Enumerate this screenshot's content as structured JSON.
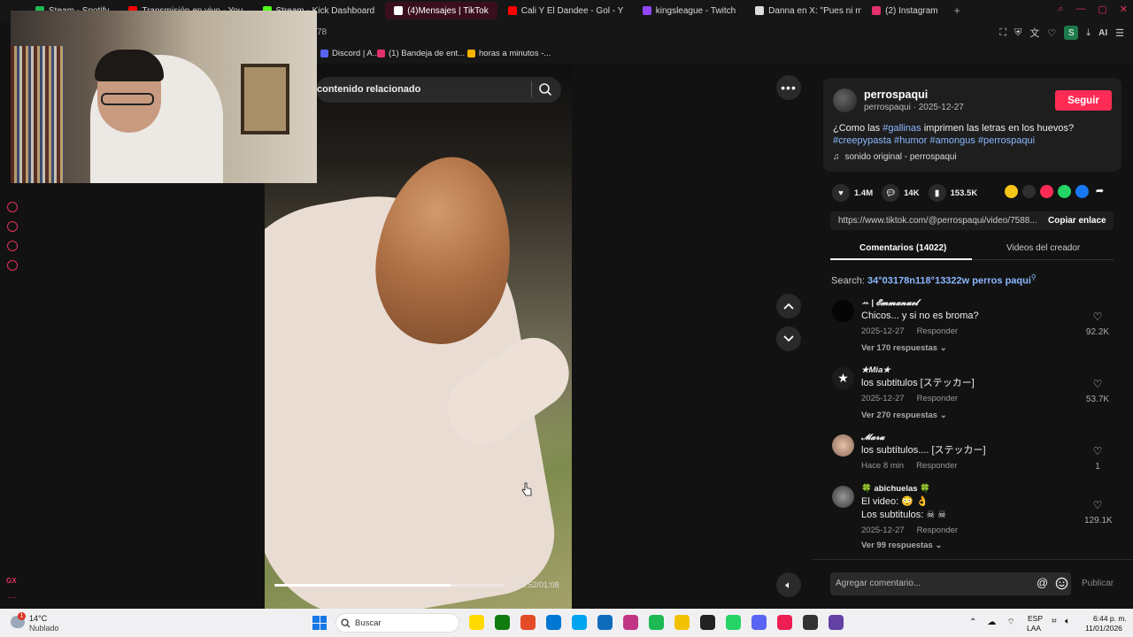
{
  "browser": {
    "tabs": [
      {
        "label": "Steam - Spotify",
        "color": "#1db954"
      },
      {
        "label": "Transmisión en vivo - You",
        "color": "#ff0000"
      },
      {
        "label": "Stream - Kick Dashboard",
        "color": "#53fc18"
      },
      {
        "label": "(4)Mensajes | TikTok",
        "color": "#ffffff"
      },
      {
        "label": "Cali Y El Dandee - Gol - Y",
        "color": "#ff0000"
      },
      {
        "label": "kingsleague - Twitch",
        "color": "#9146ff"
      },
      {
        "label": "Danna en X: \"Pues ni mod",
        "color": "#dddddd"
      },
      {
        "label": "(2) Instagram",
        "color": "#e1306c"
      }
    ],
    "new_tab": "+",
    "address_fragment": "78",
    "bookmarks": [
      {
        "label": "Discord | A...",
        "color": "#5865f2"
      },
      {
        "label": "(1) Bandeja de ent...",
        "color": "#e1306c"
      },
      {
        "label": "horas a minutos -...",
        "color": "#f4b400"
      }
    ],
    "profile_initial": "S",
    "ai_label": "AI"
  },
  "video": {
    "search_label": "contenido relacionado",
    "timecode": "00:52/01:08",
    "progress": 0.77
  },
  "post": {
    "author": "perrospaqui",
    "author_sub": "perrospaqui · 2025-12-27",
    "follow_label": "Seguir",
    "desc_text": "¿Como las ",
    "desc_tag1": "#gallinas",
    "desc_text2": " imprimen las letras en los huevos?",
    "desc_tags": "#creepypasta #humor #amongus #perrospaqui",
    "sound": "sonido original - perrospaqui",
    "likes": "1.4M",
    "comments": "14K",
    "saves": "153.5K",
    "link": "https://www.tiktok.com/@perrospaqui/video/7588...",
    "copy_label": "Copiar enlace",
    "tab_comments": "Comentarios (14022)",
    "tab_creator": "Videos del creador",
    "search_prefix": "Search:",
    "search_query": "34°03178n118°13322w perros paqui"
  },
  "comments": [
    {
      "user": "ꕀ | 𝓔𝓶𝓶𝓪𝓷𝓾𝓮𝓵",
      "text": "Chicos... y si no es broma?",
      "text2": "",
      "date": "2025-12-27",
      "reply": "Responder",
      "replies": "Ver 170 respuestas",
      "likes": "92.2K"
    },
    {
      "user": "★Mia★",
      "text": "los subtitulos [ステッカー]",
      "text2": "",
      "date": "2025-12-27",
      "reply": "Responder",
      "replies": "Ver 270 respuestas",
      "likes": "53.7K"
    },
    {
      "user": "𝓜𝓪𝓻𝓾",
      "text": "los subtítulos.... [ステッカー]",
      "text2": "",
      "date": "Hace 8 min",
      "reply": "Responder",
      "replies": "",
      "likes": "1"
    },
    {
      "user": "🍀 abichuelas 🍀",
      "text": "El video: 😳 👌",
      "text2": "Los subtitulos: ☠ ☠",
      "date": "2025-12-27",
      "reply": "Responder",
      "replies": "Ver 99 respuestas",
      "likes": "129.1K"
    }
  ],
  "composer": {
    "placeholder": "Agregar comentario...",
    "at": "@",
    "publish": "Publicar"
  },
  "taskbar": {
    "temp": "14°C",
    "weather": "Nublado",
    "badge": "1",
    "search": "Buscar",
    "lang1": "ESP",
    "lang2": "LAA",
    "time": "6:44 p. m.",
    "date": "11/01/2026",
    "apps": [
      "#ffd900",
      "#107c10",
      "#e34c26",
      "#0078d4",
      "#00a4ef",
      "#0f6cbd",
      "#c13584",
      "#1db954",
      "#f2c200",
      "#222",
      "#25d366",
      "#5865f2",
      "#ee1d52",
      "#333",
      "#6441a5"
    ]
  },
  "sidebar": {
    "gx": "GX",
    "dots": "···"
  }
}
